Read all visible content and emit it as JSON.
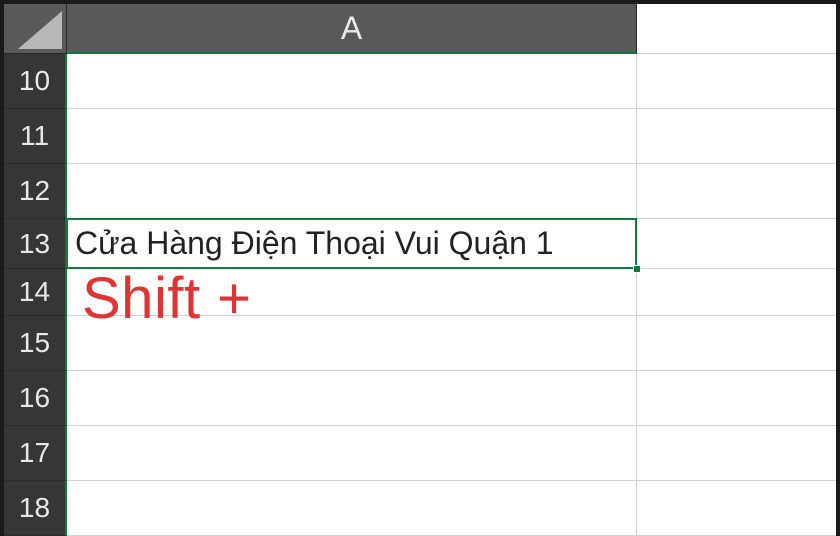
{
  "columns": [
    {
      "label": "A"
    }
  ],
  "rows": [
    {
      "number": "10",
      "cells": [
        ""
      ]
    },
    {
      "number": "11",
      "cells": [
        ""
      ]
    },
    {
      "number": "12",
      "cells": [
        ""
      ]
    },
    {
      "number": "13",
      "cells": [
        "Cửa Hàng Điện Thoại Vui Quận 1"
      ],
      "selected": true
    },
    {
      "number": "14",
      "cells": [
        ""
      ]
    },
    {
      "number": "15",
      "cells": [
        ""
      ]
    },
    {
      "number": "16",
      "cells": [
        ""
      ]
    },
    {
      "number": "17",
      "cells": [
        ""
      ]
    },
    {
      "number": "18",
      "cells": [
        ""
      ]
    }
  ],
  "annotation": "Shift +"
}
